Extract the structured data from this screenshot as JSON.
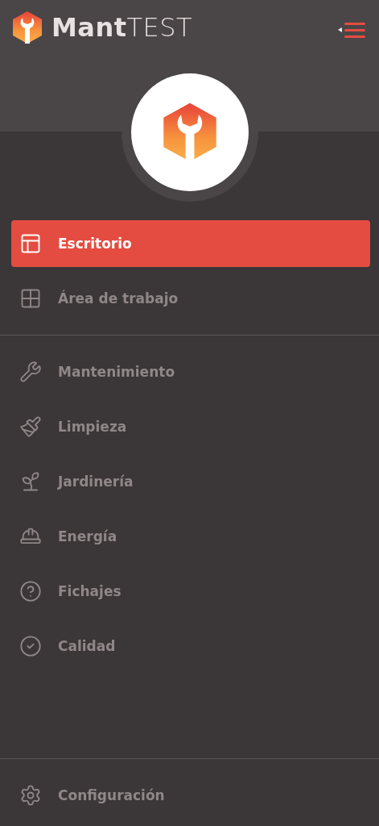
{
  "brand": {
    "name": "**Mant**TEST"
  },
  "nav": {
    "groups": [
      [
        {
          "label": "Escritorio",
          "selected": true
        },
        {
          "label": "Área de trabajo",
          "selected": false
        }
      ],
      [
        {
          "label": "Mantenimiento",
          "selected": false
        },
        {
          "label": "Limpieza",
          "selected": false
        },
        {
          "label": "Jardinería",
          "selected": false
        },
        {
          "label": "Energía",
          "selected": false
        },
        {
          "label": "Fichajes",
          "selected": false
        },
        {
          "label": "Calidad",
          "selected": false
        }
      ]
    ]
  },
  "footer": {
    "items": [
      {
        "label": "Configuración",
        "selected": false
      }
    ]
  }
}
